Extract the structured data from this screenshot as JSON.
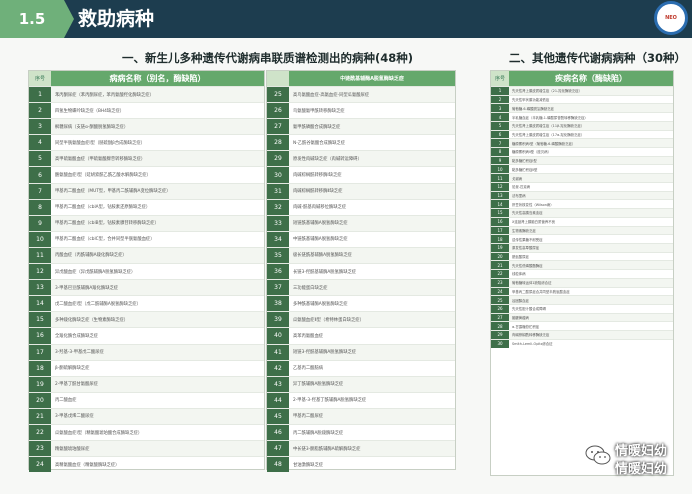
{
  "header": {
    "section_no": "1.5",
    "title": "救助病种"
  },
  "section1": {
    "title": "一、新生儿多种遗传代谢病串联质谱检测出的病种(48种)"
  },
  "section2": {
    "title": "二、其他遗传代谢病病种（30种）"
  },
  "table1": {
    "col_no": "序号",
    "col_name": "病病名称（别名，酶缺陷）",
    "rows": [
      {
        "no": "1",
        "name": "苯丙酮尿症（苯丙酮尿症，苯丙氨酸羟化酶缺乏症）"
      },
      {
        "no": "2",
        "name": "四氢生物蝶呤缺乏症（BH4缺乏症）"
      },
      {
        "no": "3",
        "name": "枫糖尿病（支链α-酮酸脱氢酶缺乏症）"
      },
      {
        "no": "4",
        "name": "同型半胱氨酸血症Ⅰ型（胱硫醚β合成酶缺乏症）"
      },
      {
        "no": "5",
        "name": "高甲硫氨酸血症（甲硫氨酸腺苷转移酶缺乏症）"
      },
      {
        "no": "6",
        "name": "酪氨酸血症Ⅰ型（延胡索酰乙酰乙酸水解酶缺乏症）"
      },
      {
        "no": "7",
        "name": "甲基丙二酸血症（MUT型，甲基丙二酰辅酶A变位酶缺乏症）"
      },
      {
        "no": "8",
        "name": "甲基丙二酸血症（cblA型，钴胺素还原酶缺乏症）"
      },
      {
        "no": "9",
        "name": "甲基丙二酸血症（cblB型，钴胺素腺苷转移酶缺乏症）"
      },
      {
        "no": "10",
        "name": "甲基丙二酸血症（cblC型，合并同型半胱氨酸血症）"
      },
      {
        "no": "11",
        "name": "丙酸血症（丙酰辅酶A羧化酶缺乏症）"
      },
      {
        "no": "12",
        "name": "异戊酸血症（异戊酰辅酶A脱氢酶缺乏症）"
      },
      {
        "no": "13",
        "name": "3-甲基巴豆酰辅酶A羧化酶缺乏症"
      },
      {
        "no": "14",
        "name": "戊二酸血症Ⅰ型（戊二酰辅酶A脱氢酶缺乏症）"
      },
      {
        "no": "15",
        "name": "多种羧化酶缺乏症（生物素酶缺乏症）"
      },
      {
        "no": "16",
        "name": "全羧化酶合成酶缺乏症"
      },
      {
        "no": "17",
        "name": "3-羟基-3-甲基戊二酸尿症"
      },
      {
        "no": "18",
        "name": "β-酮硫解酶缺乏症"
      },
      {
        "no": "19",
        "name": "2-甲基丁酰甘氨酸尿症"
      },
      {
        "no": "20",
        "name": "丙二酸血症"
      },
      {
        "no": "21",
        "name": "3-甲基戊烯二酸尿症"
      },
      {
        "no": "22",
        "name": "瓜氨酸血症Ⅰ型（精氨酸琥珀酸合成酶缺乏症）"
      },
      {
        "no": "23",
        "name": "精氨酸琥珀酸尿症"
      },
      {
        "no": "24",
        "name": "高精氨酸血症（精氨酸酶缺乏症）"
      }
    ]
  },
  "table2": {
    "col_no": "",
    "col_name": "中链酰基辅酶A脱氢酶缺乏症",
    "rows": [
      {
        "no": "25",
        "name": "高鸟氨酸血症-高氨血症-同型瓜氨酸尿症"
      },
      {
        "no": "26",
        "name": "鸟氨酸氨甲酰转移酶缺乏症"
      },
      {
        "no": "27",
        "name": "氨甲酰磷酸合成酶缺乏症"
      },
      {
        "no": "28",
        "name": "N-乙酰谷氨酸合成酶缺乏症"
      },
      {
        "no": "29",
        "name": "原发性肉碱缺乏症（肉碱转运障碍）"
      },
      {
        "no": "30",
        "name": "肉碱棕榈酰转移酶Ⅰ缺乏症"
      },
      {
        "no": "31",
        "name": "肉碱棕榈酰转移酶Ⅱ缺乏症"
      },
      {
        "no": "32",
        "name": "肉碱-酰基肉碱移位酶缺乏症"
      },
      {
        "no": "33",
        "name": "短链酰基辅酶A脱氢酶缺乏症"
      },
      {
        "no": "34",
        "name": "中链酰基辅酶A脱氢酶缺乏症"
      },
      {
        "no": "35",
        "name": "极长链酰基辅酶A脱氢酶缺乏症"
      },
      {
        "no": "36",
        "name": "长链3-羟酰基辅酶A脱氢酶缺乏症"
      },
      {
        "no": "37",
        "name": "三功能蛋白缺乏症"
      },
      {
        "no": "38",
        "name": "多种酰基辅酶A脱氢酶缺乏症"
      },
      {
        "no": "39",
        "name": "瓜氨酸血症Ⅱ型（希特林蛋白缺乏症）"
      },
      {
        "no": "40",
        "name": "高苯丙氨酸血症"
      },
      {
        "no": "41",
        "name": "短链3-羟酰基辅酶A脱氢酶缺乏症"
      },
      {
        "no": "42",
        "name": "乙基丙二酸脑病"
      },
      {
        "no": "43",
        "name": "异丁酰辅酶A脱氢酶缺乏症"
      },
      {
        "no": "44",
        "name": "2-甲基-3-羟基丁酰辅酶A脱氢酶缺乏症"
      },
      {
        "no": "45",
        "name": "甲基丙二酸尿症"
      },
      {
        "no": "46",
        "name": "丙二酰辅酶A脱羧酶缺乏症"
      },
      {
        "no": "47",
        "name": "中长链3-酮脂酰辅酶A硫解酶缺乏症"
      },
      {
        "no": "48",
        "name": "甘油激酶缺乏症"
      }
    ]
  },
  "table3": {
    "col_no": "序号",
    "col_name": "疾病名称（酶缺陷）",
    "rows": [
      {
        "no": "1",
        "name": "先天性肾上腺皮质增生症（21-羟化酶缺乏症）"
      },
      {
        "no": "2",
        "name": "先天性甲状腺功能减低症"
      },
      {
        "no": "3",
        "name": "葡萄糖-6-磷酸脱氢酶缺乏症"
      },
      {
        "no": "4",
        "name": "半乳糖血症（半乳糖-1-磷酸尿苷酰转移酶缺乏症）"
      },
      {
        "no": "5",
        "name": "先天性肾上腺皮质增生症（11β-羟化酶缺乏症）"
      },
      {
        "no": "6",
        "name": "先天性肾上腺皮质增生症（17α-羟化酶缺乏症）"
      },
      {
        "no": "7",
        "name": "糖原累积病Ⅰ型（葡萄糖-6-磷酸酶缺乏症）"
      },
      {
        "no": "8",
        "name": "糖原累积病Ⅱ型（庞贝病）"
      },
      {
        "no": "9",
        "name": "黏多糖贮积症Ⅰ型"
      },
      {
        "no": "10",
        "name": "黏多糖贮积症Ⅱ型"
      },
      {
        "no": "11",
        "name": "戈谢病"
      },
      {
        "no": "12",
        "name": "尼曼-匹克病"
      },
      {
        "no": "13",
        "name": "法布里病"
      },
      {
        "no": "14",
        "name": "肝豆状核变性（Wilson病）"
      },
      {
        "no": "15",
        "name": "先天性高胰岛素血症"
      },
      {
        "no": "16",
        "name": "X连锁肾上腺脑白质营养不良"
      },
      {
        "no": "17",
        "name": "生物素酶缺乏症"
      },
      {
        "no": "18",
        "name": "遗传性果糖不耐受症"
      },
      {
        "no": "19",
        "name": "原发性高草酸尿症"
      },
      {
        "no": "20",
        "name": "胱氨酸尿症"
      },
      {
        "no": "21",
        "name": "先天性低磷酸酯酶症"
      },
      {
        "no": "22",
        "name": "线粒体病"
      },
      {
        "no": "23",
        "name": "葡萄糖转运体1缺陷综合征"
      },
      {
        "no": "24",
        "name": "甲基丙二酸尿症合并同型半胱氨酸血症"
      },
      {
        "no": "25",
        "name": "谷固醇血症"
      },
      {
        "no": "26",
        "name": "先天性胆汁酸合成障碍"
      },
      {
        "no": "27",
        "name": "脑腱黄瘤病"
      },
      {
        "no": "28",
        "name": "α-甘露糖苷贮积症"
      },
      {
        "no": "29",
        "name": "肉碱棕榈酰转移酶缺乏症"
      },
      {
        "no": "30",
        "name": "Smith-Lemli-Opitz综合征"
      }
    ]
  },
  "watermark": {
    "line1": "情暖妇幼",
    "line2": "情暖妇幼"
  }
}
